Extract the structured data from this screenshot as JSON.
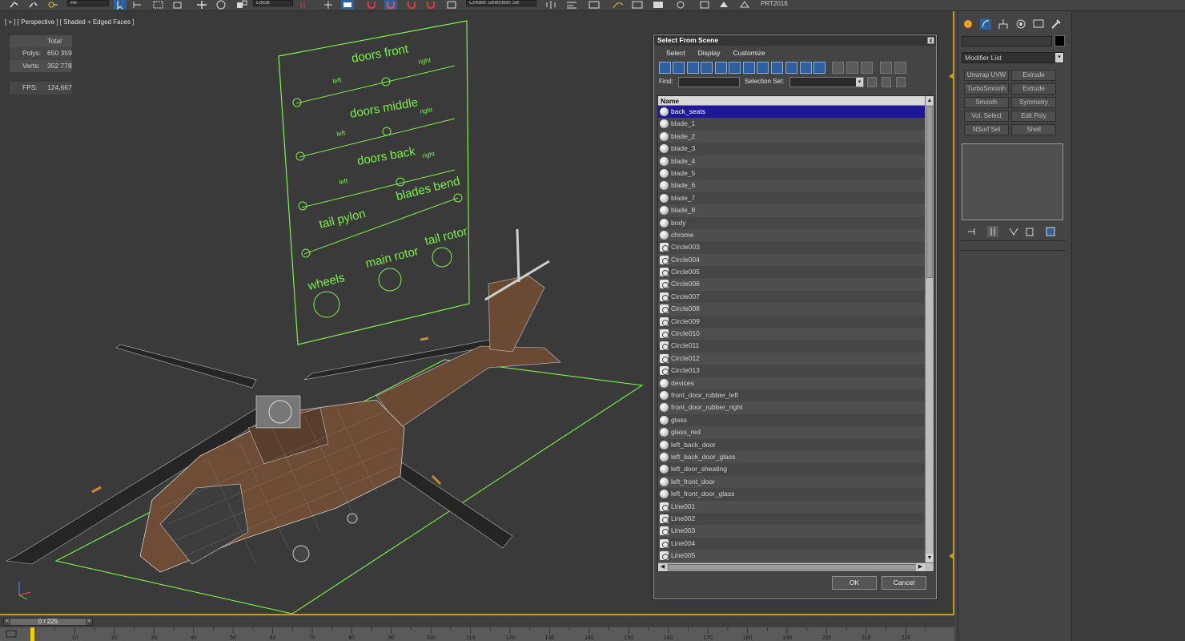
{
  "toolbar": {
    "filter_value": "All",
    "coord_value": "Local",
    "selection_set_placeholder": "Create Selection Se",
    "prt_label": "PRT2016"
  },
  "viewport": {
    "label": "[ + ] [ Perspective ] [ Shaded + Edged Faces ]",
    "stats": {
      "total_header": "Total",
      "polys_label": "Polys:",
      "polys_value": "650 359",
      "verts_label": "Verts:",
      "verts_value": "352 778",
      "fps_label": "FPS:",
      "fps_value": "124,667"
    },
    "control_panel": {
      "doors_front": "doors  front",
      "doors_middle": "doors middle",
      "doors_back": "doors back",
      "tail_pylon": "tail pylon",
      "blades_bend": "blades bend",
      "wheels": "wheels",
      "main_rotor": "main rotor",
      "tail_rotor": "tail rotor",
      "left": "left",
      "right": "right"
    }
  },
  "dialog": {
    "title": "Select From Scene",
    "close": "x",
    "menu": [
      "Select",
      "Display",
      "Customize"
    ],
    "find_label": "Find:",
    "find_value": "",
    "selection_set_label": "Selection Set:",
    "column_header": "Name",
    "ok_label": "OK",
    "cancel_label": "Cancel",
    "items": [
      {
        "name": "back_seats",
        "icon": "sphere",
        "selected": true
      },
      {
        "name": "blade_1",
        "icon": "sphere"
      },
      {
        "name": "blade_2",
        "icon": "sphere"
      },
      {
        "name": "blade_3",
        "icon": "sphere"
      },
      {
        "name": "blade_4",
        "icon": "sphere"
      },
      {
        "name": "blade_5",
        "icon": "sphere"
      },
      {
        "name": "blade_6",
        "icon": "sphere"
      },
      {
        "name": "blade_7",
        "icon": "sphere"
      },
      {
        "name": "blade_8",
        "icon": "sphere"
      },
      {
        "name": "body",
        "icon": "sphere"
      },
      {
        "name": "chrome",
        "icon": "sphere"
      },
      {
        "name": "Circle003",
        "icon": "shape"
      },
      {
        "name": "Circle004",
        "icon": "shape"
      },
      {
        "name": "Circle005",
        "icon": "shape"
      },
      {
        "name": "Circle006",
        "icon": "shape"
      },
      {
        "name": "Circle007",
        "icon": "shape"
      },
      {
        "name": "Circle008",
        "icon": "shape"
      },
      {
        "name": "Circle009",
        "icon": "shape"
      },
      {
        "name": "Circle010",
        "icon": "shape"
      },
      {
        "name": "Circle011",
        "icon": "shape"
      },
      {
        "name": "Circle012",
        "icon": "shape"
      },
      {
        "name": "Circle013",
        "icon": "shape"
      },
      {
        "name": "devices",
        "icon": "sphere"
      },
      {
        "name": "front_door_rubber_left",
        "icon": "sphere"
      },
      {
        "name": "front_door_rubber_right",
        "icon": "sphere"
      },
      {
        "name": "glass",
        "icon": "sphere"
      },
      {
        "name": "glass_red",
        "icon": "sphere"
      },
      {
        "name": "left_back_door",
        "icon": "sphere"
      },
      {
        "name": "left_back_door_glass",
        "icon": "sphere"
      },
      {
        "name": "left_door_sheating",
        "icon": "sphere"
      },
      {
        "name": "left_front_door",
        "icon": "sphere"
      },
      {
        "name": "left_front_door_glass",
        "icon": "sphere"
      },
      {
        "name": "Line001",
        "icon": "shape"
      },
      {
        "name": "Line002",
        "icon": "shape"
      },
      {
        "name": "Line003",
        "icon": "shape"
      },
      {
        "name": "Line004",
        "icon": "shape"
      },
      {
        "name": "Line005",
        "icon": "shape"
      }
    ]
  },
  "command_panel": {
    "modifier_list": "Modifier List",
    "buttons": [
      "Unwrap UVW",
      "Extrude",
      "TurboSmooth",
      "Extrude",
      "Smooth",
      "Symmetry",
      "Vol. Select",
      "Edit Poly",
      "NSurf Sel",
      "Shell"
    ]
  },
  "timeline": {
    "frame_display": "0 / 225",
    "prev": "<",
    "next": ">",
    "ticks": [
      "10",
      "20",
      "30",
      "40",
      "50",
      "60",
      "70",
      "80",
      "90",
      "100",
      "110",
      "120",
      "130",
      "140",
      "150",
      "160",
      "170",
      "180",
      "190",
      "200",
      "210",
      "220"
    ]
  },
  "colors": {
    "selection_highlight": "#1d1996",
    "viewport_border": "#c99a18",
    "wire_green": "#7cf24a",
    "stats_yellow": "#e5c94a"
  }
}
